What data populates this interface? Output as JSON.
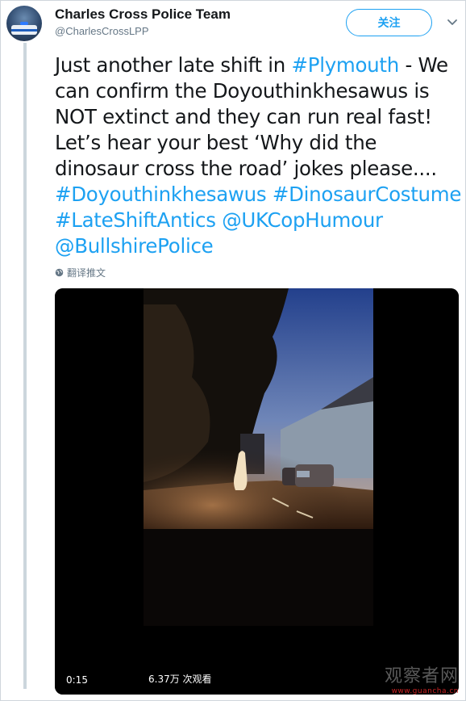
{
  "author": {
    "display_name": "Charles Cross Police Team",
    "handle": "@CharlesCrossLPP",
    "avatar_icon": "police-car-avatar"
  },
  "follow_button": {
    "label": "关注"
  },
  "menu_icon": "chevron-down-icon",
  "tweet": {
    "segments": {
      "l1_a": "Just another late shift in ",
      "l1_link": "#Plymouth",
      "l1_b": " - We",
      "l2": "can confirm the Doyouthinkhesawus is",
      "l3": "NOT extinct and they can run real fast!",
      "l4": "Let’s hear your best ‘Why did the",
      "l5": "dinosaur cross the road’ jokes please....",
      "l6_link1": "#Doyouthinkhesawus",
      "l6_link2": "#DinosaurCostume",
      "l7_link1": "#LateShiftAntics",
      "l7_link2": "@UKCopHumour",
      "l8_link1": "@BullshirePolice"
    }
  },
  "translate": {
    "label": "翻译推文",
    "icon": "globe-icon"
  },
  "video": {
    "elapsed_time": "0:15",
    "views_label": "6.37万 次观看"
  },
  "watermark": {
    "title": "观察者网",
    "url": "www.guancha.cn"
  },
  "colors": {
    "accent": "#1da1f2",
    "text": "#14171a",
    "secondary": "#657786",
    "thread_line": "#ccd6dd"
  }
}
